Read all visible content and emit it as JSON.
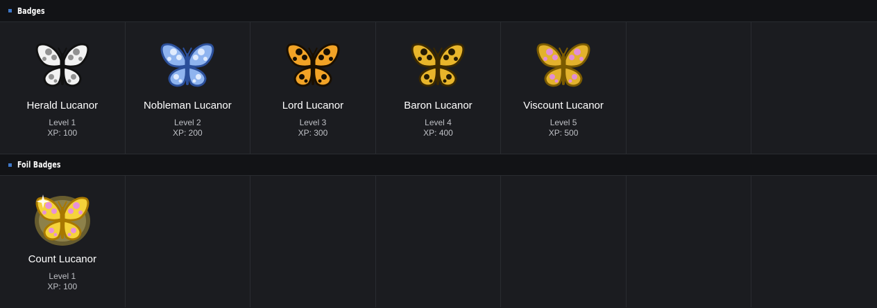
{
  "sections": [
    {
      "title": "Badges",
      "badges": [
        {
          "name": "Herald Lucanor",
          "level": "Level 1",
          "xp": "XP: 100",
          "icon": "butterfly-silver-icon",
          "wing": "#f2f2f2",
          "edge": "#111111",
          "spot": "#888888"
        },
        {
          "name": "Nobleman Lucanor",
          "level": "Level 2",
          "xp": "XP: 200",
          "icon": "butterfly-blue-icon",
          "wing": "#8fb4ef",
          "edge": "#2b4f9a",
          "spot": "#e9f1ff"
        },
        {
          "name": "Lord Lucanor",
          "level": "Level 3",
          "xp": "XP: 300",
          "icon": "butterfly-orange-icon",
          "wing": "#f2a326",
          "edge": "#1a0f00",
          "spot": "#000000"
        },
        {
          "name": "Baron Lucanor",
          "level": "Level 4",
          "xp": "XP: 400",
          "icon": "butterfly-gold-icon",
          "wing": "#e8b52b",
          "edge": "#3a2800",
          "spot": "#120c00"
        },
        {
          "name": "Viscount Lucanor",
          "level": "Level 5",
          "xp": "XP: 500",
          "icon": "butterfly-pink-gold-icon",
          "wing": "#e3b22d",
          "edge": "#7a5a00",
          "spot": "#e28ce8"
        }
      ]
    },
    {
      "title": "Foil Badges",
      "badges": [
        {
          "name": "Count Lucanor",
          "level": "Level 1",
          "xp": "XP: 100",
          "icon": "butterfly-foil-icon",
          "wing": "#f5d33a",
          "edge": "#a87800",
          "spot": "#e68ae8"
        }
      ]
    }
  ],
  "colors": {
    "background": "#1b1c20",
    "header": "#121316",
    "bullet": "#3f78c8"
  }
}
